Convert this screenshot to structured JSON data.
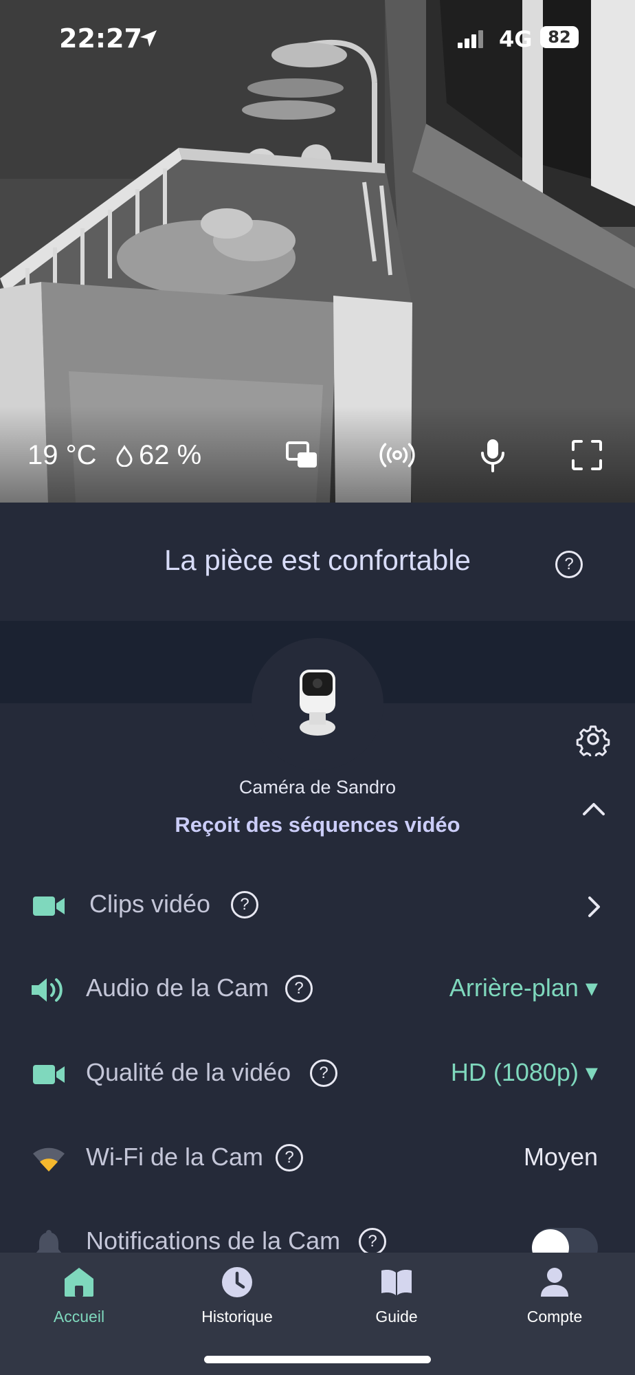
{
  "status_bar": {
    "time": "22:27",
    "network": "4G",
    "battery": "82"
  },
  "video": {
    "temperature": "19 °C",
    "humidity": "62 %",
    "controls": [
      "picture-in-picture-icon",
      "sound-waves-icon",
      "microphone-icon",
      "fullscreen-icon"
    ]
  },
  "comfort": {
    "message": "La pièce est confortable",
    "help": "?"
  },
  "camera": {
    "name": "Caméra de Sandro",
    "status": "Reçoit des séquences vidéo"
  },
  "settings": {
    "clips": {
      "label": "Clips vidéo",
      "help": "?"
    },
    "audio": {
      "label": "Audio de la Cam",
      "help": "?",
      "value": "Arrière-plan ▾"
    },
    "quality": {
      "label": "Qualité de la vidéo",
      "help": "?",
      "value": "HD (1080p) ▾"
    },
    "wifi": {
      "label": "Wi-Fi de la Cam",
      "help": "?",
      "value": "Moyen"
    },
    "notifications": {
      "label": "Notifications de la Cam",
      "help": "?",
      "enabled": false
    }
  },
  "tabs": [
    {
      "label": "Accueil",
      "icon": "home-icon",
      "active": true
    },
    {
      "label": "Historique",
      "icon": "clock-icon",
      "active": false
    },
    {
      "label": "Guide",
      "icon": "book-icon",
      "active": false
    },
    {
      "label": "Compte",
      "icon": "person-icon",
      "active": false
    }
  ],
  "colors": {
    "accent": "#7fd8bd",
    "background": "#252a39",
    "band": "#1b2231",
    "tabbar": "#323745",
    "wifi_signal": "#f5b82e"
  }
}
